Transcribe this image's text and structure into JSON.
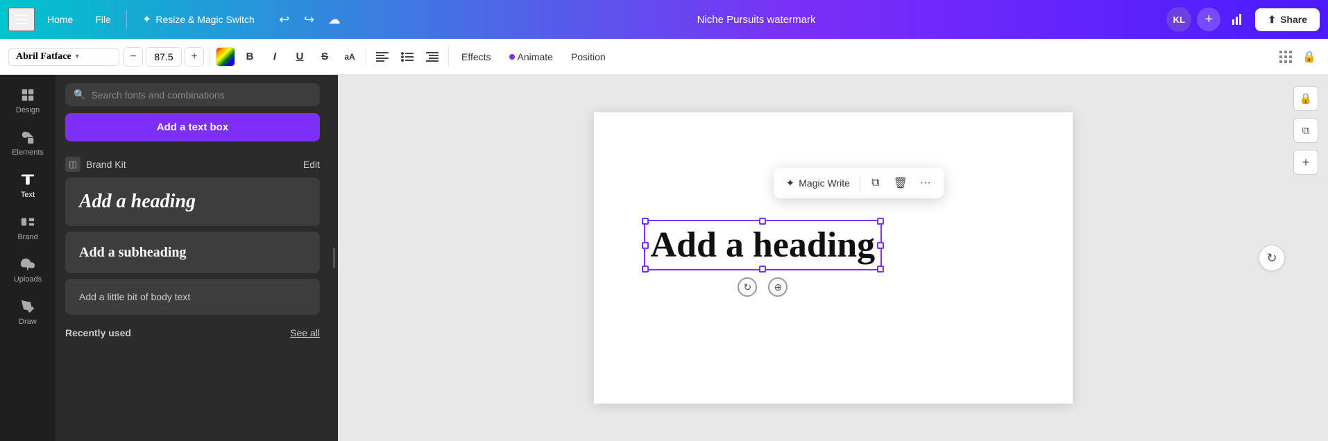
{
  "topnav": {
    "hamburger_label": "Menu",
    "home_label": "Home",
    "file_label": "File",
    "magic_switch_label": "Resize & Magic Switch",
    "undo_icon": "↩",
    "redo_icon": "↪",
    "cloud_icon": "☁",
    "project_title": "Niche Pursuits watermark",
    "avatar_initials": "KL",
    "add_icon": "+",
    "share_icon": "⬆",
    "share_label": "Share"
  },
  "toolbar": {
    "font_name": "Abril Fatface",
    "font_size": "87.5",
    "decrease_icon": "−",
    "increase_icon": "+",
    "color_label": "Text color",
    "bold_label": "B",
    "italic_label": "I",
    "underline_label": "U",
    "strikethrough_label": "S",
    "case_label": "aA",
    "align_left_label": "≡",
    "list_label": "≡",
    "indent_label": "≡",
    "effects_label": "Effects",
    "animate_label": "Animate",
    "position_label": "Position",
    "pattern_icon": "⊞",
    "lock_icon": "🔒"
  },
  "sidebar": {
    "items": [
      {
        "label": "Design",
        "icon": "design"
      },
      {
        "label": "Elements",
        "icon": "elements"
      },
      {
        "label": "Text",
        "icon": "text"
      },
      {
        "label": "Brand",
        "icon": "brand"
      },
      {
        "label": "Uploads",
        "icon": "uploads"
      },
      {
        "label": "Draw",
        "icon": "draw"
      }
    ],
    "active_item": "Text"
  },
  "text_panel": {
    "search_placeholder": "Search fonts and combinations",
    "add_textbox_label": "Add a text box",
    "brand_kit_label": "Brand Kit",
    "edit_label": "Edit",
    "heading_text": "Add a heading",
    "subheading_text": "Add a subheading",
    "body_text": "Add a little bit of body text",
    "recently_used_label": "Recently used",
    "see_all_label": "See all"
  },
  "canvas": {
    "floating_toolbar": {
      "magic_write_label": "Magic Write",
      "magic_write_icon": "✦",
      "copy_icon": "⧉",
      "delete_icon": "🗑",
      "more_icon": "···"
    },
    "selected_text": "Add a heading",
    "rotate_icon": "↻",
    "move_icon": "⊕"
  },
  "right_sidebar": {
    "lock_icon": "🔒",
    "duplicate_icon": "⧉",
    "add_icon": "+"
  },
  "canvas_right": {
    "refresh_icon": "↻"
  }
}
